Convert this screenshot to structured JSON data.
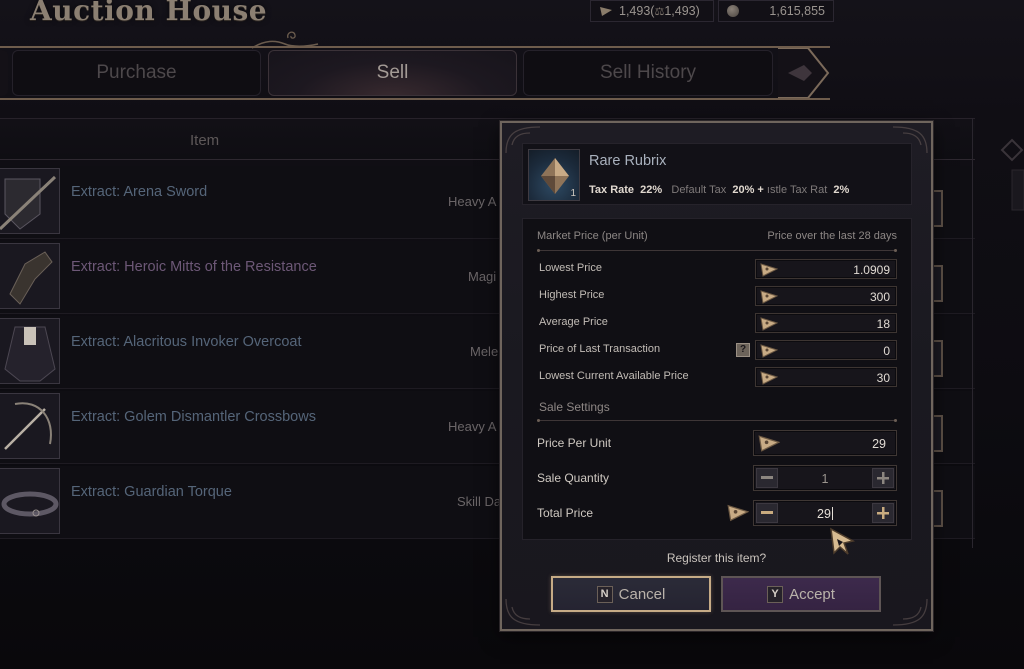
{
  "window": {
    "title": "Auction House"
  },
  "currency": {
    "primary_amount": "1,493",
    "primary_tradable": "1,493",
    "gold_amount": "1,615,855"
  },
  "tabs": [
    {
      "label": "Purchase",
      "active": false
    },
    {
      "label": "Sell",
      "active": true
    },
    {
      "label": "Sell History",
      "active": false
    }
  ],
  "list": {
    "column_item": "Item",
    "rows": [
      {
        "name": "Extract: Arena Sword",
        "category": "Heavy A",
        "color": "blue"
      },
      {
        "name": "Extract: Heroic Mitts of the Resistance",
        "category": "Magi",
        "color": "purple"
      },
      {
        "name": "Extract: Alacritous Invoker Overcoat",
        "category": "Mele",
        "color": "blue"
      },
      {
        "name": "Extract: Golem Dismantler Crossbows",
        "category": "Heavy A",
        "color": "blue"
      },
      {
        "name": "Extract: Guardian Torque",
        "category": "Skill Da",
        "color": "blue"
      }
    ]
  },
  "dialog": {
    "item": {
      "name": "Rare Rubrix",
      "quantity": "1",
      "icon": "rubrix-crystal-icon",
      "tax_rate_label": "Tax Rate",
      "tax_rate": "22%",
      "default_tax_label": "Default Tax",
      "default_tax": "20%",
      "plus": "+",
      "castle_tax_label": "ıstle Tax Rat",
      "castle_tax": "2%"
    },
    "market": {
      "header_left": "Market Price (per Unit)",
      "header_right": "Price over the last 28 days",
      "rows": [
        {
          "label": "Lowest Price",
          "value": "1.0909"
        },
        {
          "label": "Highest Price",
          "value": "300"
        },
        {
          "label": "Average Price",
          "value": "18"
        },
        {
          "label": "Price of Last Transaction",
          "value": "0",
          "help": "?"
        },
        {
          "label": "Lowest Current Available Price",
          "value": "30"
        }
      ]
    },
    "sale": {
      "header": "Sale Settings",
      "price_per_unit_label": "Price Per Unit",
      "price_per_unit": "29",
      "quantity_label": "Sale Quantity",
      "quantity": "1",
      "total_label": "Total Price",
      "total": "29"
    },
    "confirm_text": "Register this item?",
    "cancel": {
      "key": "N",
      "label": "Cancel"
    },
    "accept": {
      "key": "Y",
      "label": "Accept"
    }
  },
  "colors": {
    "accent_gold": "#c6ab86",
    "accept_purple": "#3d2a4c",
    "item_name_blue": "#556579",
    "item_name_purple": "#6d5877"
  }
}
